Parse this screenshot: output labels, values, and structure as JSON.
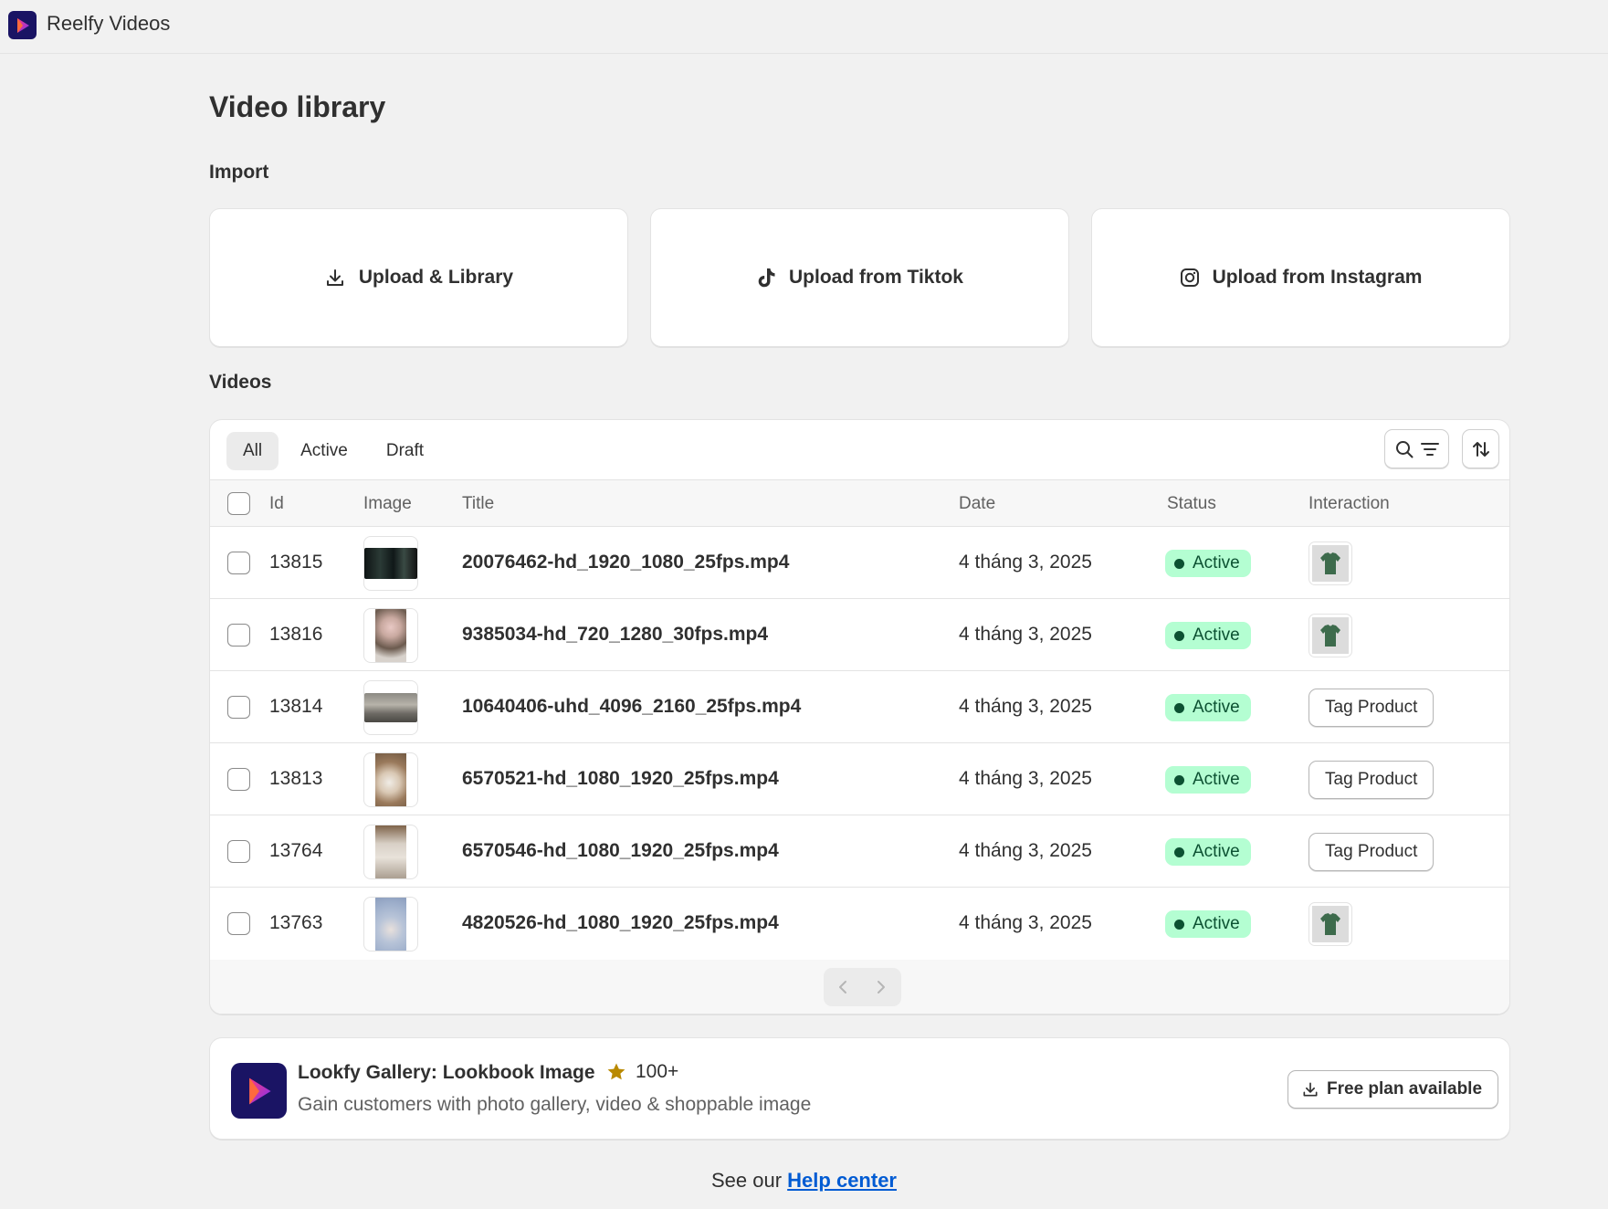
{
  "app": {
    "name": "Reelfy Videos"
  },
  "page": {
    "title": "Video library"
  },
  "import": {
    "heading": "Import",
    "cards": [
      {
        "label": "Upload & Library",
        "icon": "download-icon"
      },
      {
        "label": "Upload from Tiktok",
        "icon": "tiktok-icon"
      },
      {
        "label": "Upload from Instagram",
        "icon": "instagram-icon"
      }
    ]
  },
  "videos": {
    "heading": "Videos",
    "tabs": [
      {
        "label": "All",
        "selected": true
      },
      {
        "label": "Active",
        "selected": false
      },
      {
        "label": "Draft",
        "selected": false
      }
    ],
    "columns": {
      "id": "Id",
      "image": "Image",
      "title": "Title",
      "date": "Date",
      "status": "Status",
      "interaction": "Interaction"
    },
    "rows": [
      {
        "id": "13815",
        "title": "20076462-hd_1920_1080_25fps.mp4",
        "date": "4 tháng 3, 2025",
        "status": "Active",
        "interaction": "product-thumbnail",
        "tag_label": ""
      },
      {
        "id": "13816",
        "title": "9385034-hd_720_1280_30fps.mp4",
        "date": "4 tháng 3, 2025",
        "status": "Active",
        "interaction": "product-thumbnail",
        "tag_label": ""
      },
      {
        "id": "13814",
        "title": "10640406-uhd_4096_2160_25fps.mp4",
        "date": "4 tháng 3, 2025",
        "status": "Active",
        "interaction": "tag-button",
        "tag_label": "Tag Product"
      },
      {
        "id": "13813",
        "title": "6570521-hd_1080_1920_25fps.mp4",
        "date": "4 tháng 3, 2025",
        "status": "Active",
        "interaction": "tag-button",
        "tag_label": "Tag Product"
      },
      {
        "id": "13764",
        "title": "6570546-hd_1080_1920_25fps.mp4",
        "date": "4 tháng 3, 2025",
        "status": "Active",
        "interaction": "tag-button",
        "tag_label": "Tag Product"
      },
      {
        "id": "13763",
        "title": "4820526-hd_1080_1920_25fps.mp4",
        "date": "4 tháng 3, 2025",
        "status": "Active",
        "interaction": "product-thumbnail",
        "tag_label": ""
      }
    ]
  },
  "promo": {
    "name": "Lookfy Gallery: Lookbook Image",
    "rating_count": "100+",
    "description": "Gain customers with photo gallery, video & shoppable image",
    "button_label": "Free plan available"
  },
  "footer": {
    "prefix": "See our ",
    "link_text": "Help center"
  },
  "colors": {
    "brand_dark": "#1a1464",
    "brand_gradient_start": "#ff3b7a",
    "brand_gradient_end": "#7b2ff7",
    "status_bg": "#b4fed2",
    "status_text": "#0c5132",
    "link": "#005bd3",
    "star": "#b98900"
  }
}
